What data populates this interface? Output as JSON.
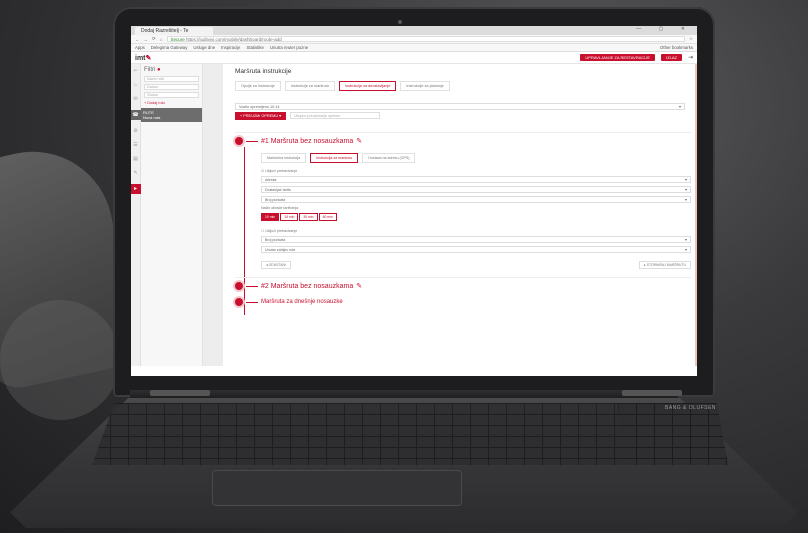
{
  "browser": {
    "tab_title": "Dodaj Razrešitelj - Te",
    "window_controls": "— ▢ ✕",
    "url_prefix": "Secure",
    "url": "https://juditvivi.com/mobile/dashboard/route-add",
    "bookmarks": [
      "Apps",
      "Delegirna Gateway",
      "Usluge dne",
      "Inspiracije",
      "Statistike",
      "Unutra reuter pozne"
    ],
    "bookmarks_other": "Other bookmarks"
  },
  "app": {
    "logo_text": "imt",
    "logo_accent": "✎",
    "header_button": "UPRAVLJANJE ZA RESTAVRACIJE",
    "header_button_small": "IZLAZ",
    "signout_icon": "⇥"
  },
  "sidebar": {
    "icons": [
      "⇐",
      "⌂",
      "✉",
      "⚙",
      "☰",
      "▤",
      "✎",
      "⎙"
    ],
    "dark_item": "☎",
    "red_item": "▸"
  },
  "filters": {
    "title": "Filtri",
    "title_marker": "●",
    "input1": "Naziv rute",
    "input2": "Datum",
    "input3": "Status",
    "link": "+ Dodaj rutu",
    "selected_line1": "RUTE",
    "selected_line2": "Nova ruta"
  },
  "main": {
    "page_title": "Maršruta instrukcije",
    "tabs": [
      "Opcije za instrukcije",
      "Instrukcije za maršrutu",
      "Instrukcije za deostavljanje",
      "Instrukcije za plaćanje"
    ],
    "active_tab_index": 2,
    "vehicle_select": "Vozilo opremljeno 10.14",
    "add_button": "+ PREUZMI OPREMU ▾",
    "input_placeholder": "Ukupno preuzimanje opreme"
  },
  "route1": {
    "title": "#1 Maršruta bez nosauzkama",
    "edit_icon": "✎",
    "options": [
      "Maršrutna instrukcija",
      "Instrukcija za maršrutu",
      "Dostava na adresu (GPS)"
    ],
    "active_option_index": 1,
    "check1": "Uključi prebacivanje",
    "select1": "Adresa",
    "select2": "Dostavljač tarifa",
    "select3": "Broj punkata",
    "chips_label": "Način obrade tarifiranja",
    "chips": [
      "10 min",
      "15 min",
      "30 min",
      "60 min"
    ],
    "active_chip_index": 0,
    "check2": "Uključi prebacivanje",
    "select4": "Broj punkata",
    "select5": "Unutar zahtjev rute",
    "back_button": "◂ ODUSTANI",
    "next_button": "▸ STORNIRAJ MARŠRUTU"
  },
  "route2": {
    "title": "#2 Maršruta bez nosauzkama",
    "edit_icon": "✎"
  },
  "route3": {
    "title": "Maršruta za dnešnje nosauzke"
  },
  "laptop": {
    "brand_tag": "BANG & OLUFSEN"
  },
  "colors": {
    "accent": "#c8102e",
    "accent_soft": "#f5c8ce"
  }
}
